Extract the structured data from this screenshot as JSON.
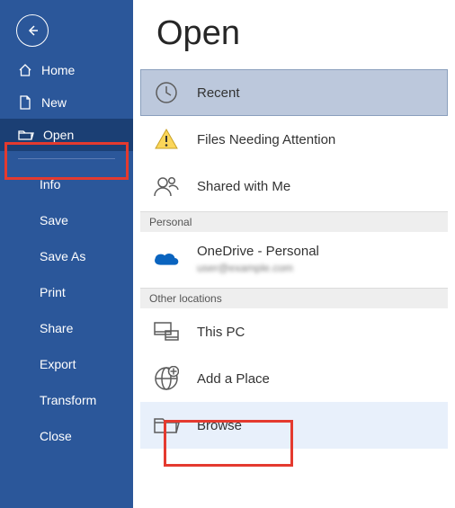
{
  "sidebar": {
    "home": "Home",
    "new": "New",
    "open": "Open",
    "info": "Info",
    "save": "Save",
    "saveAs": "Save As",
    "print": "Print",
    "share": "Share",
    "export": "Export",
    "transform": "Transform",
    "close": "Close"
  },
  "main": {
    "title": "Open",
    "recent": "Recent",
    "filesNeedingAttention": "Files Needing Attention",
    "sharedWithMe": "Shared with Me",
    "sections": {
      "personal": "Personal",
      "otherLocations": "Other locations"
    },
    "onedrive": {
      "label": "OneDrive - Personal",
      "sub": "user@example.com"
    },
    "thisPC": "This PC",
    "addAPlace": "Add a Place",
    "browse": "Browse"
  }
}
